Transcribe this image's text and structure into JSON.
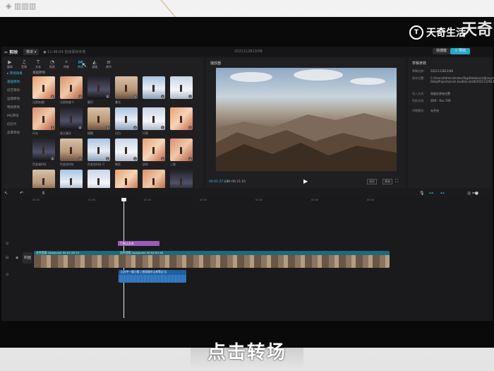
{
  "desk": {
    "corner_logo": "◈ ▥▥▥"
  },
  "watermark": {
    "logo_text": "天奇生活",
    "icon": "T",
    "big_text": "天奇"
  },
  "app": {
    "logo": "✂ 剪映",
    "menu": "菜单 ▾",
    "save_status": "● 11:48:04 自动保存本地",
    "project_title": "2021112813/08",
    "shortcut_button": "快捷键",
    "export_button": "⇪ 导出"
  },
  "toolbar": [
    {
      "icon": "▶",
      "label": "媒体",
      "iconname": "media-icon"
    },
    {
      "icon": "♫",
      "label": "音频",
      "iconname": "audio-icon"
    },
    {
      "icon": "T",
      "label": "文本",
      "iconname": "text-icon"
    },
    {
      "icon": "◔",
      "label": "贴纸",
      "iconname": "sticker-icon"
    },
    {
      "icon": "✧",
      "label": "特效",
      "iconname": "effects-icon"
    },
    {
      "icon": "⋈",
      "label": "转场",
      "iconname": "transition-icon"
    },
    {
      "icon": "◭",
      "label": "滤镜",
      "iconname": "filter-icon"
    },
    {
      "icon": "≡",
      "label": "调节",
      "iconname": "adjust-icon"
    }
  ],
  "sidebar": [
    "▸ 转场效果",
    "基础转场",
    "综艺转场",
    "运镜转场",
    "特效转场",
    "MG转场",
    "幻灯片",
    "遮罩转场"
  ],
  "grid": {
    "title": "基础转场",
    "items": [
      "无限穿越I",
      "无限穿越 II",
      "翻页",
      "叠化",
      "",
      "",
      "闪光",
      "复古漏光",
      "模糊",
      "闪白",
      "闪黑",
      "",
      "色差顺时针",
      "色差逆时针",
      "色差逆时针 II",
      "撕纸",
      "放射",
      "上移",
      "",
      "",
      "",
      "",
      "",
      ""
    ]
  },
  "player": {
    "title": "播放器",
    "current_time": "00:01:27:14",
    "duration": "/ 00:06:21:01",
    "play_icon": "▶",
    "ratio_label": "适应",
    "ratio2_label": "原始",
    "fullscreen_icon": "⛶"
  },
  "props": {
    "title": "草稿参数",
    "rows": [
      {
        "k": "草稿名称:",
        "v": "2021112813/08"
      },
      {
        "k": "保存位置:",
        "v": "C:/Users/Administrator/AppData/Local/JianyingPro/User Data/Projects/com.lveditor.draft/2021112813/08"
      },
      {
        "k": "导入方式:",
        "v": "保留在原有位置"
      },
      {
        "k": "色彩空间:",
        "v": "SDR - Rec.709"
      },
      {
        "k": "代理模式:",
        "v": "未开启"
      }
    ]
  },
  "timeline_tools": {
    "select": "↖",
    "undo": "↶",
    "split": "Ⅱ",
    "mic": "🎙",
    "link1": "⊶",
    "link2": "⊷",
    "zoom": "◎ ━●"
  },
  "ruler": [
    "00:00",
    "01:00",
    "02:00",
    "03:00",
    "04:00",
    "05:00",
    "06:00"
  ],
  "tracks": {
    "text_clip": "T 默认文本",
    "cover_label": "封面",
    "video_clip_1": "文件音频 1b/k/Junk4  00:01:26:13",
    "video_clip_2": "文件音频 1b/k/Junk4  00:04:50:18",
    "audio_clip": "山谷中一楼小楼 | 旅游城市山林等边 乐"
  },
  "subtitle": "点击转场"
}
